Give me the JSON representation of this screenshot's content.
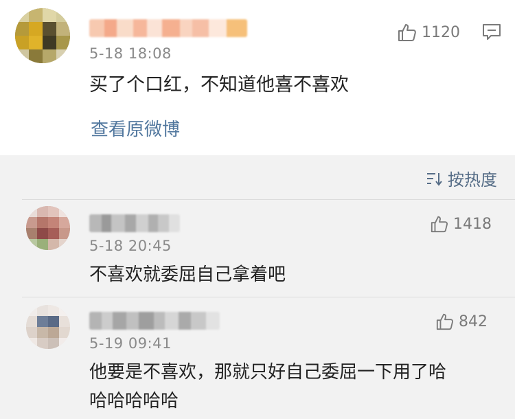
{
  "post": {
    "timestamp": "5-18 18:08",
    "likes": "1120",
    "content": "买了个口红，不知道他喜不喜欢",
    "view_original": "查看原微博"
  },
  "sort": {
    "label": "按热度"
  },
  "comments": [
    {
      "timestamp": "5-18 20:45",
      "likes": "1418",
      "content": "不喜欢就委屈自己拿着吧"
    },
    {
      "timestamp": "5-19 09:41",
      "likes": "842",
      "content_line1": "他要是不喜欢，那就只好自己委屈一下用了哈",
      "content_line2": "哈哈哈哈哈"
    }
  ],
  "icons": [
    "thumbs-up-icon",
    "comment-icon",
    "sort-icon"
  ],
  "colors": {
    "link": "#51779e",
    "sort": "#566d87",
    "meta": "#8a8a8a",
    "background": "#f2f2f2"
  }
}
